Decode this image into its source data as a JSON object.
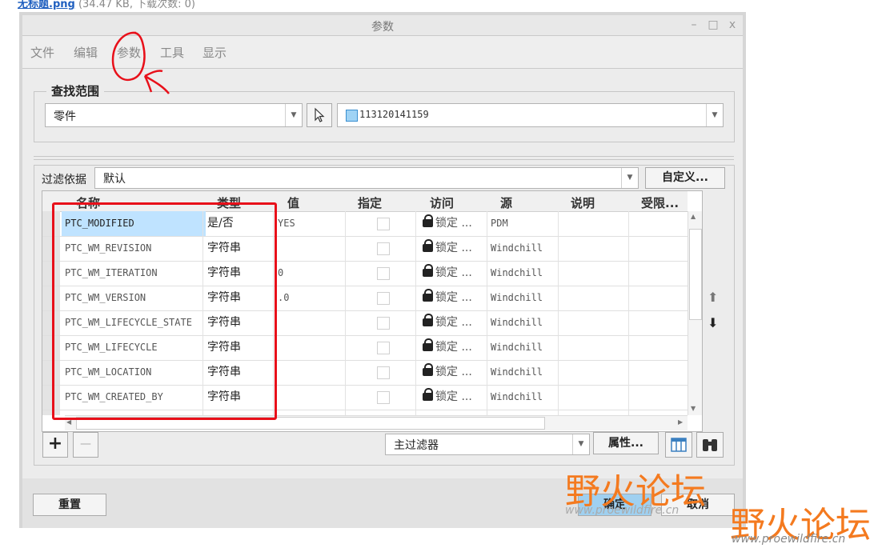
{
  "top_note": {
    "link": "无标题.png",
    "meta": "(34.47 KB, 下载次数: 0)"
  },
  "window": {
    "title": "参数",
    "minimize": "–",
    "maximize": "□",
    "close": "x"
  },
  "menu": [
    "文件",
    "编辑",
    "参数",
    "工具",
    "显示"
  ],
  "find_scope": {
    "title": "查找范围",
    "type_value": "零件",
    "model_value": "113120141159"
  },
  "filter": {
    "label": "过滤依据",
    "value": "默认",
    "custom_button": "自定义..."
  },
  "table": {
    "columns": [
      "名称",
      "类型",
      "值",
      "指定",
      "访问",
      "源",
      "说明",
      "受限..."
    ],
    "rows": [
      {
        "name": "PTC_MODIFIED",
        "type": "是/否",
        "value": "YES",
        "access": "锁定 ...",
        "source": "PDM"
      },
      {
        "name": "PTC_WM_REVISION",
        "type": "字符串",
        "value": "",
        "access": "锁定 ...",
        "source": "Windchill"
      },
      {
        "name": "PTC_WM_ITERATION",
        "type": "字符串",
        "value": "0",
        "access": "锁定 ...",
        "source": "Windchill"
      },
      {
        "name": "PTC_WM_VERSION",
        "type": "字符串",
        "value": ".0",
        "access": "锁定 ...",
        "source": "Windchill"
      },
      {
        "name": "PTC_WM_LIFECYCLE_STATE",
        "type": "字符串",
        "value": "",
        "access": "锁定 ...",
        "source": "Windchill"
      },
      {
        "name": "PTC_WM_LIFECYCLE",
        "type": "字符串",
        "value": "",
        "access": "锁定 ...",
        "source": "Windchill"
      },
      {
        "name": "PTC_WM_LOCATION",
        "type": "字符串",
        "value": "",
        "access": "锁定 ...",
        "source": "Windchill"
      },
      {
        "name": "PTC_WM_CREATED_BY",
        "type": "字符串",
        "value": "",
        "access": "锁定 ...",
        "source": "Windchill"
      }
    ]
  },
  "bottom_controls": {
    "add": "+",
    "remove": "—",
    "main_filter": "主过滤器",
    "properties": "属性..."
  },
  "footer": {
    "reset": "重置",
    "ok": "确定",
    "cancel": "取消"
  },
  "watermark": {
    "text": "野火论坛",
    "url": "www.proewildfire.cn"
  },
  "colors": {
    "annotation_red": "#e8101a",
    "selected_cell": "#bfe3ff",
    "watermark_orange": "#f47a1f"
  }
}
